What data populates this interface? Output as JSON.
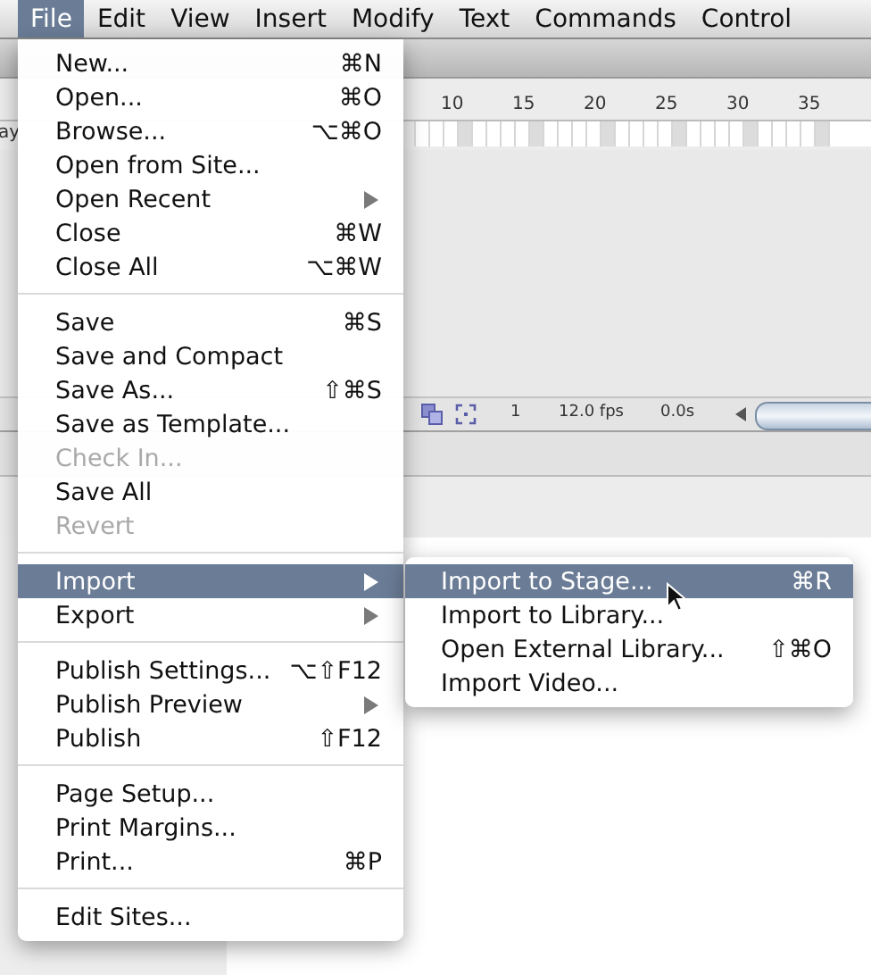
{
  "menu_bar": [
    {
      "label": "File",
      "selected": true
    },
    {
      "label": "Edit",
      "selected": false
    },
    {
      "label": "View",
      "selected": false
    },
    {
      "label": "Insert",
      "selected": false
    },
    {
      "label": "Modify",
      "selected": false
    },
    {
      "label": "Text",
      "selected": false
    },
    {
      "label": "Commands",
      "selected": false
    },
    {
      "label": "Control",
      "selected": false
    }
  ],
  "timeline": {
    "layer_label": "ay",
    "ruler": [
      "10",
      "15",
      "20",
      "25",
      "30",
      "35"
    ],
    "frame": "1",
    "fps": "12.0 fps",
    "time": "0.0s"
  },
  "file_menu": [
    {
      "kind": "item",
      "label": "New...",
      "shortcut": "⌘N",
      "disabled": false,
      "selected": false,
      "submenu": false
    },
    {
      "kind": "item",
      "label": "Open...",
      "shortcut": "⌘O",
      "disabled": false,
      "selected": false,
      "submenu": false
    },
    {
      "kind": "item",
      "label": "Browse...",
      "shortcut": "⌥⌘O",
      "disabled": false,
      "selected": false,
      "submenu": false
    },
    {
      "kind": "item",
      "label": "Open from Site...",
      "disabled": false,
      "selected": false,
      "submenu": false
    },
    {
      "kind": "item",
      "label": "Open Recent",
      "disabled": false,
      "selected": false,
      "submenu": true
    },
    {
      "kind": "item",
      "label": "Close",
      "shortcut": "⌘W",
      "disabled": false,
      "selected": false,
      "submenu": false
    },
    {
      "kind": "item",
      "label": "Close All",
      "shortcut": "⌥⌘W",
      "disabled": false,
      "selected": false,
      "submenu": false
    },
    {
      "kind": "separator"
    },
    {
      "kind": "item",
      "label": "Save",
      "shortcut": "⌘S",
      "disabled": false,
      "selected": false,
      "submenu": false
    },
    {
      "kind": "item",
      "label": "Save and Compact",
      "disabled": false,
      "selected": false,
      "submenu": false
    },
    {
      "kind": "item",
      "label": "Save As...",
      "shortcut": "⇧⌘S",
      "disabled": false,
      "selected": false,
      "submenu": false
    },
    {
      "kind": "item",
      "label": "Save as Template...",
      "disabled": false,
      "selected": false,
      "submenu": false
    },
    {
      "kind": "item",
      "label": "Check In...",
      "disabled": true,
      "selected": false,
      "submenu": false
    },
    {
      "kind": "item",
      "label": "Save All",
      "disabled": false,
      "selected": false,
      "submenu": false
    },
    {
      "kind": "item",
      "label": "Revert",
      "disabled": true,
      "selected": false,
      "submenu": false
    },
    {
      "kind": "separator"
    },
    {
      "kind": "item",
      "label": "Import",
      "disabled": false,
      "selected": true,
      "submenu": true
    },
    {
      "kind": "item",
      "label": "Export",
      "disabled": false,
      "selected": false,
      "submenu": true
    },
    {
      "kind": "separator"
    },
    {
      "kind": "item",
      "label": "Publish Settings...",
      "shortcut": "⌥⇧F12",
      "disabled": false,
      "selected": false,
      "submenu": false
    },
    {
      "kind": "item",
      "label": "Publish Preview",
      "disabled": false,
      "selected": false,
      "submenu": true
    },
    {
      "kind": "item",
      "label": "Publish",
      "shortcut": "⇧F12",
      "disabled": false,
      "selected": false,
      "submenu": false
    },
    {
      "kind": "separator"
    },
    {
      "kind": "item",
      "label": "Page Setup...",
      "disabled": false,
      "selected": false,
      "submenu": false
    },
    {
      "kind": "item",
      "label": "Print Margins...",
      "disabled": false,
      "selected": false,
      "submenu": false
    },
    {
      "kind": "item",
      "label": "Print...",
      "shortcut": "⌘P",
      "disabled": false,
      "selected": false,
      "submenu": false
    },
    {
      "kind": "separator"
    },
    {
      "kind": "item",
      "label": "Edit Sites...",
      "disabled": false,
      "selected": false,
      "submenu": false
    }
  ],
  "import_submenu": [
    {
      "kind": "item",
      "label": "Import to Stage...",
      "shortcut": "⌘R",
      "disabled": false,
      "selected": true,
      "submenu": false
    },
    {
      "kind": "item",
      "label": "Import to Library...",
      "disabled": false,
      "selected": false,
      "submenu": false
    },
    {
      "kind": "item",
      "label": "Open External Library...",
      "shortcut": "⇧⌘O",
      "disabled": false,
      "selected": false,
      "submenu": false
    },
    {
      "kind": "item",
      "label": "Import Video...",
      "disabled": false,
      "selected": false,
      "submenu": false
    }
  ]
}
